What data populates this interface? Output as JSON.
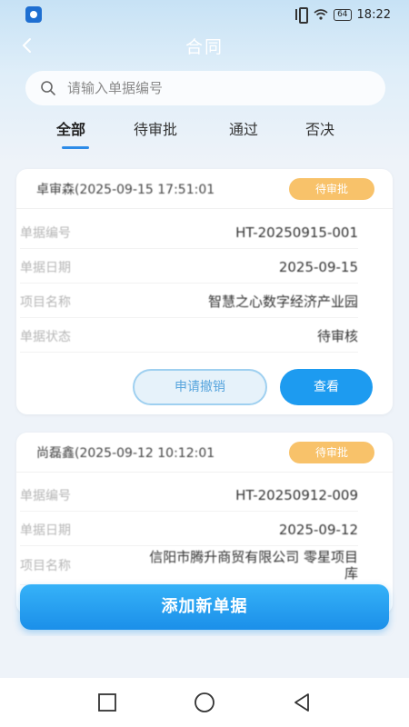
{
  "status_bar": {
    "time": "18:22",
    "battery": "64"
  },
  "nav": {
    "title": "合同"
  },
  "search": {
    "placeholder": "请输入单据编号"
  },
  "tabs": [
    {
      "label": "全部",
      "active": true
    },
    {
      "label": "待审批",
      "active": false
    },
    {
      "label": "通过",
      "active": false
    },
    {
      "label": "否决",
      "active": false
    }
  ],
  "cards": [
    {
      "title": "卓审森(2025-09-15 17:51:01",
      "status_badge": "待审批",
      "rows": [
        {
          "label": "单据编号",
          "value": "HT-20250915-001"
        },
        {
          "label": "单据日期",
          "value": "2025-09-15"
        },
        {
          "label": "项目名称",
          "value": "智慧之心数字经济产业园"
        },
        {
          "label": "单据状态",
          "value": "待审核"
        }
      ],
      "actions": {
        "secondary": "申请撤销",
        "primary": "查看"
      }
    },
    {
      "title": "尚磊鑫(2025-09-12 10:12:01",
      "status_badge": "待审批",
      "rows": [
        {
          "label": "单据编号",
          "value": "HT-20250912-009"
        },
        {
          "label": "单据日期",
          "value": "2025-09-12"
        },
        {
          "label": "项目名称",
          "value": "信阳市腾升商贸有限公司 零星项目库"
        }
      ]
    }
  ],
  "add_button": {
    "label": "添加新单据"
  },
  "colors": {
    "accent": "#1d9bf0",
    "badge": "#f8c26a",
    "tab_underline": "#2b8be8"
  }
}
